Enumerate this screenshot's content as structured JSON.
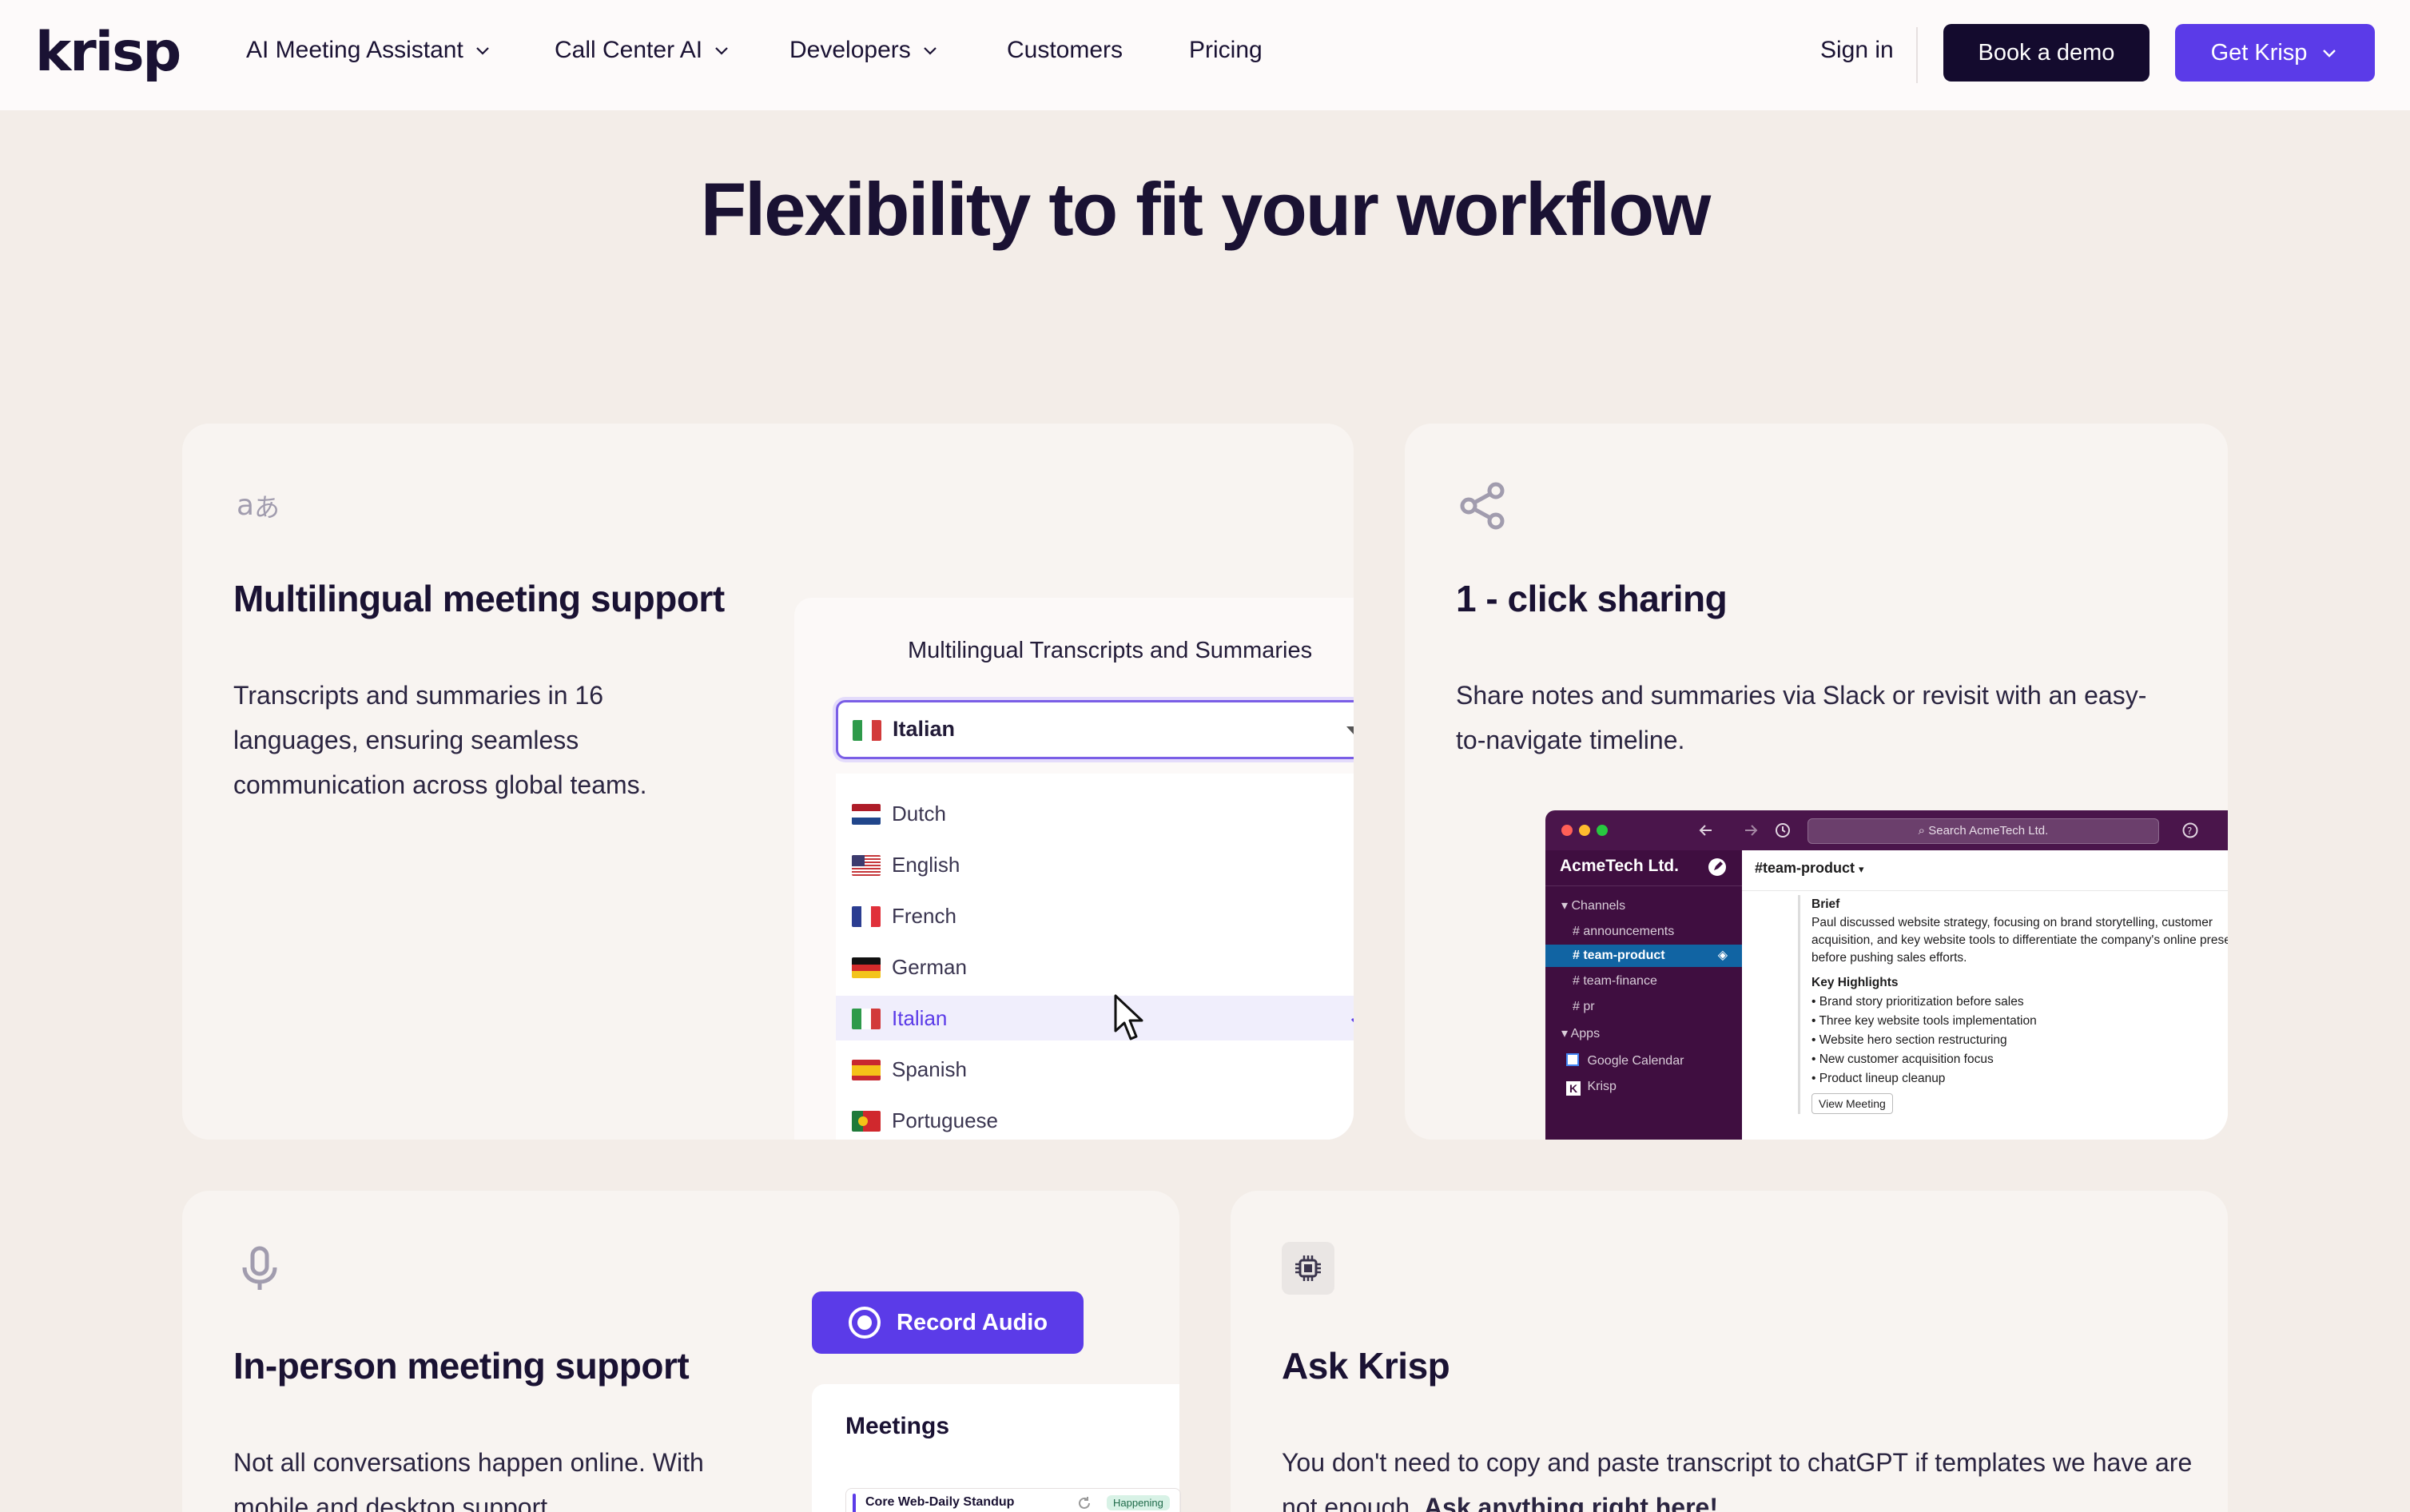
{
  "nav": {
    "logo": "krisp",
    "items": [
      {
        "label": "AI Meeting Assistant",
        "has_dropdown": true
      },
      {
        "label": "Call Center AI",
        "has_dropdown": true
      },
      {
        "label": "Developers",
        "has_dropdown": true
      },
      {
        "label": "Customers",
        "has_dropdown": false
      },
      {
        "label": "Pricing",
        "has_dropdown": false
      }
    ],
    "sign_in": "Sign in",
    "book_demo": "Book a demo",
    "get_krisp": "Get Krisp"
  },
  "headline": "Flexibility to fit your workflow",
  "cards": {
    "multilingual": {
      "icon": "translate-icon",
      "title": "Multilingual meeting support",
      "text": "Transcripts and summaries in 16 languages, ensuring seamless communication across global teams.",
      "panel_title": "Multilingual Transcripts and Summaries",
      "selected": "Italian",
      "options": [
        "Dutch",
        "English",
        "French",
        "German",
        "Italian",
        "Spanish",
        "Portuguese"
      ]
    },
    "sharing": {
      "icon": "share-icon",
      "title": "1 - click sharing",
      "text": "Share notes and summaries via Slack or revisit with an easy-to-navigate timeline.",
      "slack": {
        "search": "Search AcmeTech Ltd.",
        "workspace": "AcmeTech Ltd.",
        "channels_label": "Channels",
        "channels": [
          "announcements",
          "team-product",
          "team-finance",
          "pr"
        ],
        "active_channel": "team-product",
        "apps_label": "Apps",
        "apps": [
          "Google Calendar",
          "Krisp"
        ],
        "channel_header": "#team-product",
        "brief_label": "Brief",
        "brief": "Paul discussed website strategy, focusing on brand storytelling, customer acquisition, and key website tools to differentiate the company's online presence before pushing sales efforts.",
        "highlights_label": "Key Highlights",
        "highlights": [
          "Brand story prioritization before sales",
          "Three key website tools implementation",
          "Website hero section restructuring",
          "New customer acquisition focus",
          "Product lineup cleanup"
        ],
        "view_meeting": "View Meeting"
      }
    },
    "inperson": {
      "icon": "microphone-icon",
      "title": "In-person meeting support",
      "text": "Not all conversations happen online. With mobile and desktop support,",
      "record_button": "Record Audio",
      "meetings_title": "Meetings",
      "meeting_row": "Core Web-Daily Standup",
      "meeting_badge": "Happening"
    },
    "ask": {
      "icon": "ai-chip-icon",
      "title": "Ask Krisp",
      "text_plain": "You don't need to copy and paste transcript to chatGPT if templates we have are not enough. ",
      "text_bold": "Ask anything right here!"
    }
  },
  "colors": {
    "accent": "#5b3be8",
    "dark": "#140b2e",
    "background": "#f3ede8",
    "card": "#f8f4f1",
    "slack_sidebar": "#3f0e40"
  }
}
